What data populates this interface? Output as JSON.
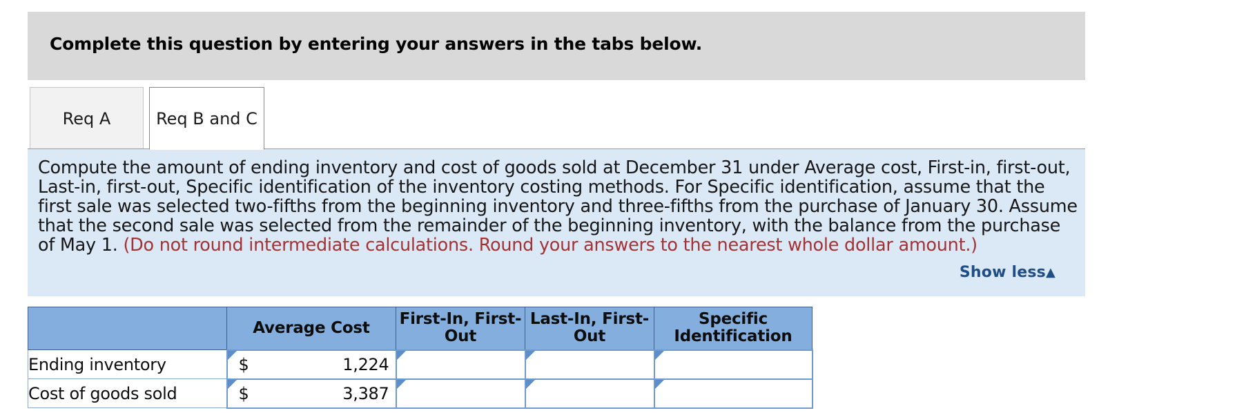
{
  "banner": {
    "title": "Complete this question by entering your answers in the tabs below."
  },
  "tabs": [
    {
      "label": "Req A",
      "active": false
    },
    {
      "label": "Req B and C",
      "active": true
    }
  ],
  "instructions": {
    "body": "Compute the amount of ending inventory and cost of goods sold at December 31 under Average cost, First-in, first-out, Last-in, first-out, Specific identification of the inventory costing methods. For Specific identification, assume that the first sale was selected two-fifths from the beginning inventory and three-fifths from the purchase of January 30. Assume that the second sale was selected from the remainder of the beginning inventory, with the balance from the purchase of May 1. ",
    "red_note": "(Do not round intermediate calculations. Round your answers to the nearest whole dollar amount.)",
    "show_less_label": "Show less",
    "show_less_caret": "▲",
    "red_color": "#a33232",
    "link_color": "#1f4e86",
    "panel_color": "#dbe8f6"
  },
  "table": {
    "header_color": "#84aedd",
    "columns": [
      {
        "key": "blank",
        "label": ""
      },
      {
        "key": "average_cost",
        "label": "Average Cost"
      },
      {
        "key": "fifo",
        "label": "First-In, First-Out"
      },
      {
        "key": "lifo",
        "label": "Last-In, First-Out"
      },
      {
        "key": "specific",
        "label": "Specific Identification"
      }
    ],
    "rows": [
      {
        "label": "Ending inventory",
        "average_cost": {
          "symbol": "$",
          "value": "1,224"
        },
        "fifo": {
          "symbol": "",
          "value": ""
        },
        "lifo": {
          "symbol": "",
          "value": ""
        },
        "specific": {
          "symbol": "",
          "value": ""
        }
      },
      {
        "label": "Cost of goods sold",
        "average_cost": {
          "symbol": "$",
          "value": "3,387"
        },
        "fifo": {
          "symbol": "",
          "value": ""
        },
        "lifo": {
          "symbol": "",
          "value": ""
        },
        "specific": {
          "symbol": "",
          "value": ""
        }
      }
    ]
  }
}
